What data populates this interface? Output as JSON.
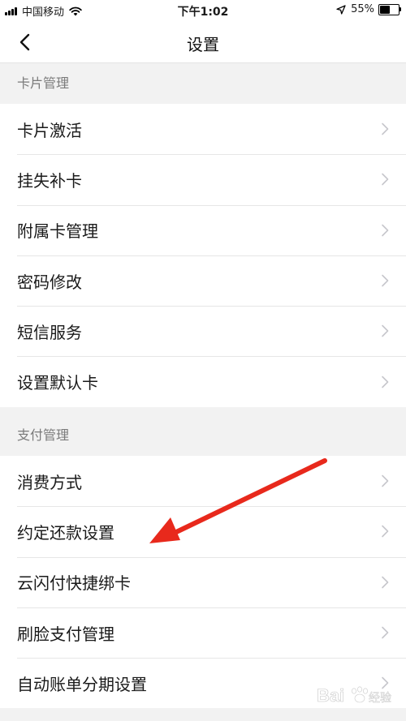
{
  "status_bar": {
    "carrier": "中国移动",
    "time": "下午1:02",
    "battery": "55%",
    "battery_level": 0.55,
    "signal_icon": "signal-bars-icon",
    "wifi_icon": "wifi-icon",
    "location_icon": "location-arrow-icon"
  },
  "nav": {
    "title": "设置",
    "back_icon": "chevron-left-icon"
  },
  "sections": [
    {
      "header": "卡片管理",
      "items": [
        "卡片激活",
        "挂失补卡",
        "附属卡管理",
        "密码修改",
        "短信服务",
        "设置默认卡"
      ]
    },
    {
      "header": "支付管理",
      "items": [
        "消费方式",
        "约定还款设置",
        "云闪付快捷绑卡",
        "刷脸支付管理",
        "自动账单分期设置"
      ]
    }
  ],
  "annotation": {
    "type": "red-arrow",
    "color": "#e8291c",
    "points_to": "约定还款设置"
  },
  "watermark": {
    "text": "Bai经验",
    "icon": "baidu-paw-icon"
  },
  "colors": {
    "background": "#f2f2f2",
    "section_header_text": "#7a7a7a",
    "chevron": "#c7c7cc",
    "divider": "#e6e6e6"
  }
}
